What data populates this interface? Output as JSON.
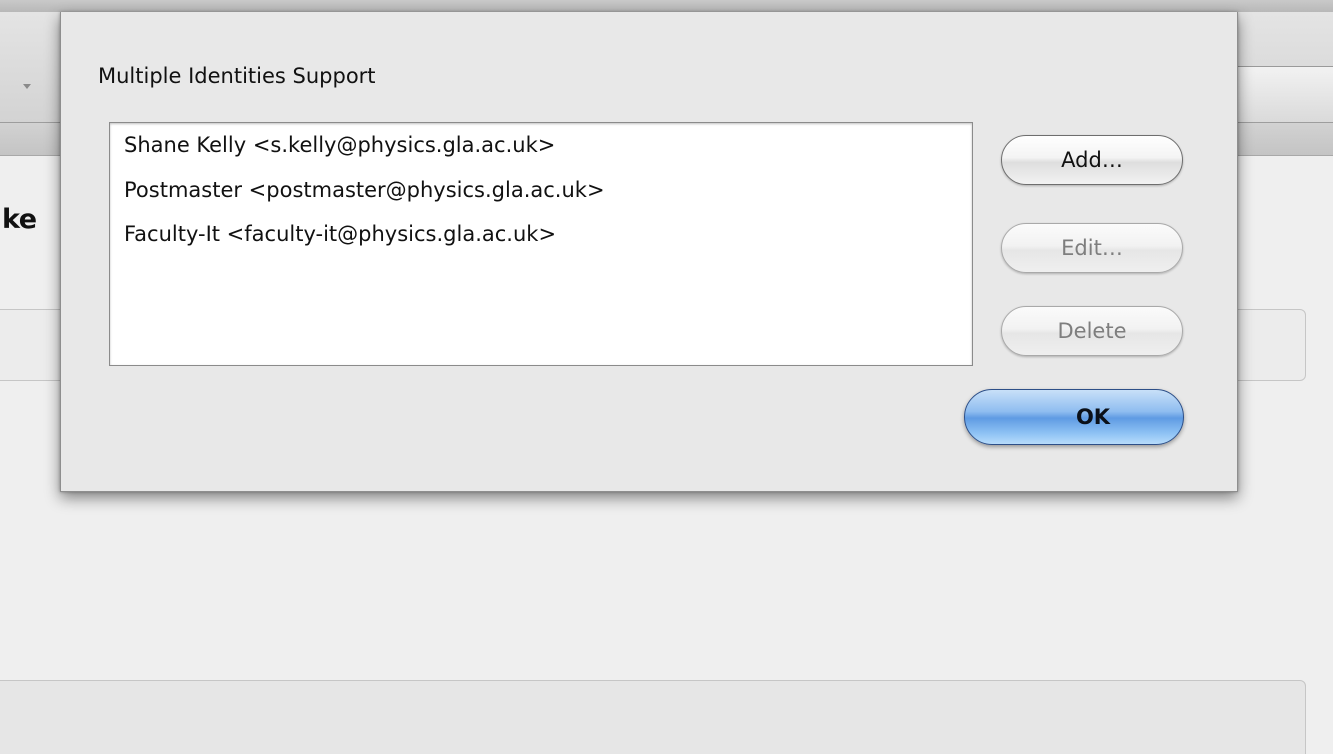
{
  "background": {
    "partial_title": "ke"
  },
  "dialog": {
    "title": "Multiple Identities Support",
    "identities": [
      "Shane Kelly <s.kelly@physics.gla.ac.uk>",
      "Postmaster <postmaster@physics.gla.ac.uk>",
      "Faculty-It <faculty-it@physics.gla.ac.uk>"
    ],
    "buttons": {
      "add": "Add…",
      "edit": "Edit…",
      "delete": "Delete",
      "ok": "OK"
    },
    "button_states": {
      "add_enabled": true,
      "edit_enabled": false,
      "delete_enabled": false,
      "ok_default": true
    }
  }
}
